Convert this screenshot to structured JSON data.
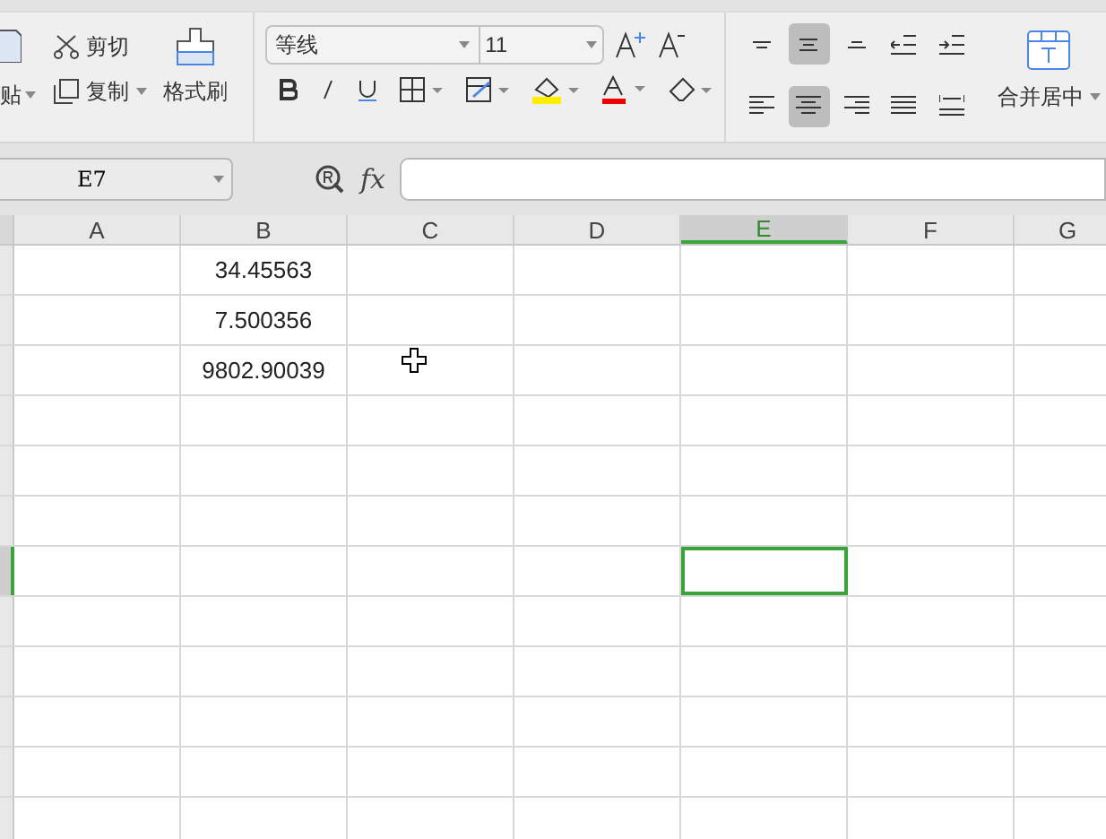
{
  "clipboard": {
    "paste": "贴",
    "cut": "剪切",
    "copy": "复制",
    "format_painter": "格式刷"
  },
  "font": {
    "family": "等线",
    "size": "11"
  },
  "alignment": [
    {
      "selected": false
    },
    {
      "selected": true
    },
    {
      "selected": false
    },
    {
      "selected": false
    },
    {
      "selected": false
    },
    {
      "selected": false
    },
    {
      "selected": true
    },
    {
      "selected": false
    },
    {
      "selected": false
    },
    {
      "selected": false
    }
  ],
  "merge": "合并居中",
  "name_box": "E7",
  "formula_label": "fx",
  "columns": [
    {
      "label": "A",
      "selected": false
    },
    {
      "label": "B",
      "selected": false
    },
    {
      "label": "C",
      "selected": false
    },
    {
      "label": "D",
      "selected": false
    },
    {
      "label": "E",
      "selected": true
    },
    {
      "label": "F",
      "selected": false
    },
    {
      "label": "G",
      "selected": false
    }
  ],
  "rows": [
    {
      "selected": false,
      "b": "34.45563"
    },
    {
      "selected": false,
      "b": "7.500356"
    },
    {
      "selected": false,
      "b": "9802.90039"
    },
    {
      "selected": false
    },
    {
      "selected": false
    },
    {
      "selected": false
    },
    {
      "selected": true
    },
    {
      "selected": false
    },
    {
      "selected": false
    },
    {
      "selected": false
    },
    {
      "selected": false
    },
    {
      "selected": false
    }
  ]
}
